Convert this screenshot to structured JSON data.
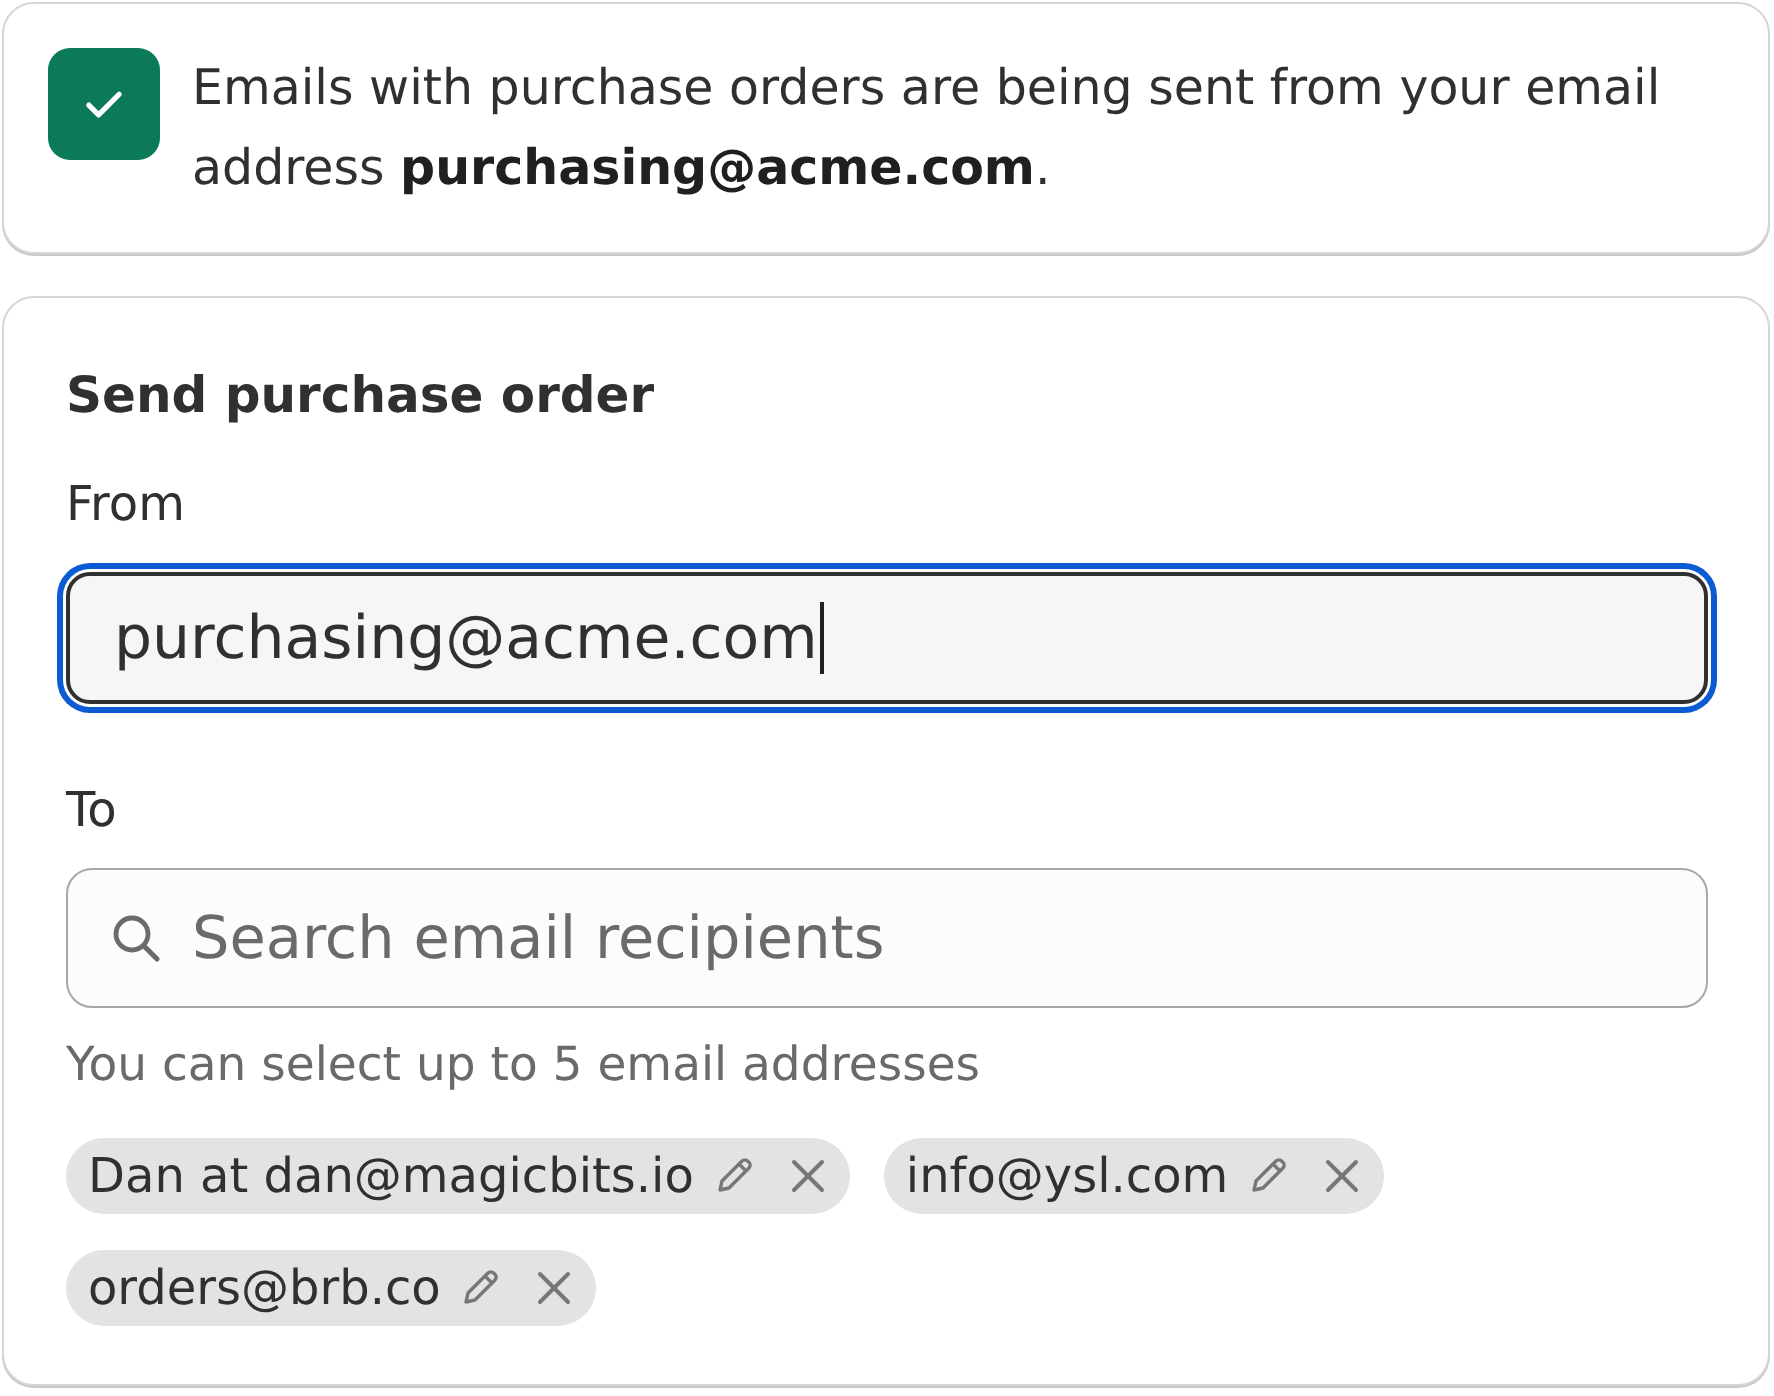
{
  "notice": {
    "kind": "success",
    "text": "Emails with purchase orders are being sent from your email address **purchasing@acme.com**."
  },
  "form": {
    "title": "Send purchase order",
    "from": {
      "label": "From",
      "value": "purchasing@acme.com",
      "focused": true
    },
    "to": {
      "label": "To",
      "placeholder": "Search email recipients",
      "help": "You can select up to 5 email addresses",
      "recipients": [
        {
          "label": "Dan at dan@magicbits.io"
        },
        {
          "label": "info@ysl.com"
        },
        {
          "label": "orders@brb.co"
        }
      ]
    }
  }
}
